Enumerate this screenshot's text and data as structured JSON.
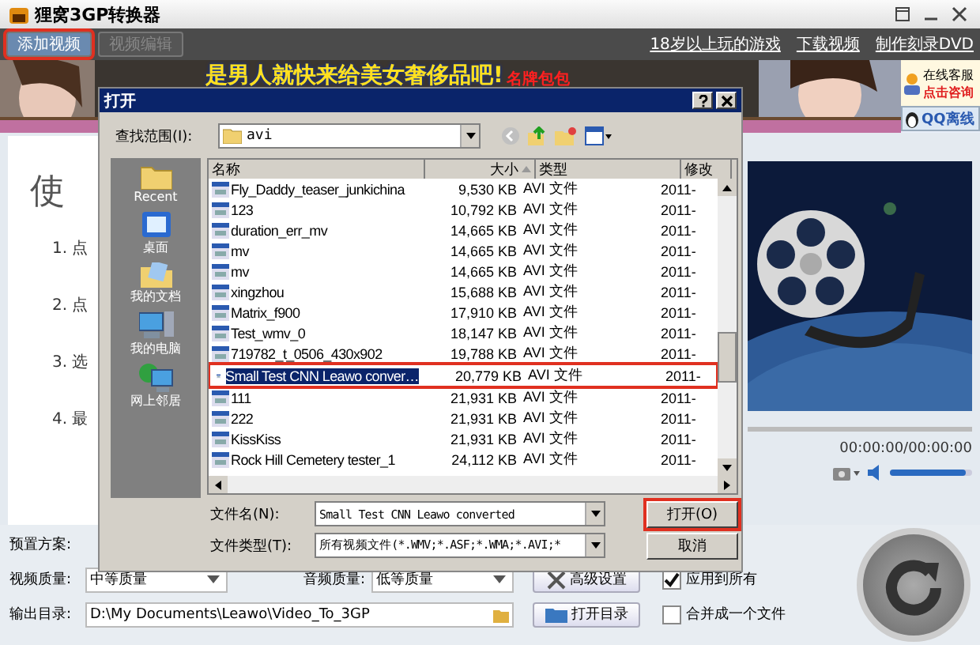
{
  "window": {
    "title": "狸窝3GP转换器"
  },
  "toolbar": {
    "buttons": [
      {
        "label": "添加视频",
        "disabled": false,
        "highlighted": true
      },
      {
        "label": "视频编辑",
        "disabled": true,
        "highlighted": false
      }
    ],
    "links": [
      "18岁以上玩的游戏",
      "下载视频",
      "制作刻录DVD"
    ]
  },
  "banner": {
    "headline": "是男人就快来给美女奢侈品吧!",
    "tag": "名牌包包"
  },
  "support": {
    "title": "在线客服",
    "action": "点击咨询",
    "qq": "QQ离线"
  },
  "guide": {
    "heading": "使",
    "steps": [
      "1. 点",
      "2. 点",
      "3. 选",
      "4. 最"
    ]
  },
  "player": {
    "time": "00:00:00/00:00:00",
    "volume": {
      "level": 0.92
    }
  },
  "settings": {
    "preset_label": "预置方案:",
    "video_quality": {
      "label": "视频质量:",
      "value": "中等质量"
    },
    "audio_quality": {
      "label": "音频质量:",
      "value": "低等质量"
    },
    "advanced_button": "高级设置",
    "apply_all": {
      "label": "应用到所有",
      "checked": true
    },
    "output_label": "输出目录:",
    "output_path": "D:\\My Documents\\Leawo\\Video_To_3GP",
    "open_folder_button": "打开目录",
    "merge": {
      "label": "合并成一个文件",
      "checked": false
    }
  },
  "dialog": {
    "title": "打开",
    "look_in_label": "查找范围(I):",
    "look_in": "avi",
    "places": [
      "Recent",
      "桌面",
      "我的文档",
      "我的电脑",
      "网上邻居"
    ],
    "columns": [
      "名称",
      "大小",
      "类型",
      "修改"
    ],
    "files": [
      {
        "name": "Fly_Daddy_teaser_junkichina",
        "size": "9,530 KB",
        "type": "AVI 文件",
        "modified": "2011-",
        "selected": false
      },
      {
        "name": "123",
        "size": "10,792 KB",
        "type": "AVI 文件",
        "modified": "2011-",
        "selected": false
      },
      {
        "name": "duration_err_mv",
        "size": "14,665 KB",
        "type": "AVI 文件",
        "modified": "2011-",
        "selected": false
      },
      {
        "name": "mv",
        "size": "14,665 KB",
        "type": "AVI 文件",
        "modified": "2011-",
        "selected": false
      },
      {
        "name": "mv",
        "size": "14,665 KB",
        "type": "AVI 文件",
        "modified": "2011-",
        "selected": false
      },
      {
        "name": "xingzhou",
        "size": "15,688 KB",
        "type": "AVI 文件",
        "modified": "2011-",
        "selected": false
      },
      {
        "name": "Matrix_f900",
        "size": "17,910 KB",
        "type": "AVI 文件",
        "modified": "2011-",
        "selected": false
      },
      {
        "name": "Test_wmv_0",
        "size": "18,147 KB",
        "type": "AVI 文件",
        "modified": "2011-",
        "selected": false
      },
      {
        "name": "719782_t_0506_430x902",
        "size": "19,788 KB",
        "type": "AVI 文件",
        "modified": "2011-",
        "selected": false
      },
      {
        "name": "Small Test CNN Leawo conver…",
        "size": "20,779 KB",
        "type": "AVI 文件",
        "modified": "2011-",
        "selected": true
      },
      {
        "name": "111",
        "size": "21,931 KB",
        "type": "AVI 文件",
        "modified": "2011-",
        "selected": false
      },
      {
        "name": "222",
        "size": "21,931 KB",
        "type": "AVI 文件",
        "modified": "2011-",
        "selected": false
      },
      {
        "name": "KissKiss",
        "size": "21,931 KB",
        "type": "AVI 文件",
        "modified": "2011-",
        "selected": false
      },
      {
        "name": "Rock Hill Cemetery tester_1",
        "size": "24,112 KB",
        "type": "AVI 文件",
        "modified": "2011-",
        "selected": false
      }
    ],
    "filename_label": "文件名(N):",
    "filename": "Small Test CNN Leawo converted",
    "filetype_label": "文件类型(T):",
    "filetype": "所有视频文件(*.WMV;*.ASF;*.WMA;*.AVI;*",
    "open_button": {
      "label": "打开(O)",
      "highlighted": true
    },
    "cancel_button": "取消"
  }
}
